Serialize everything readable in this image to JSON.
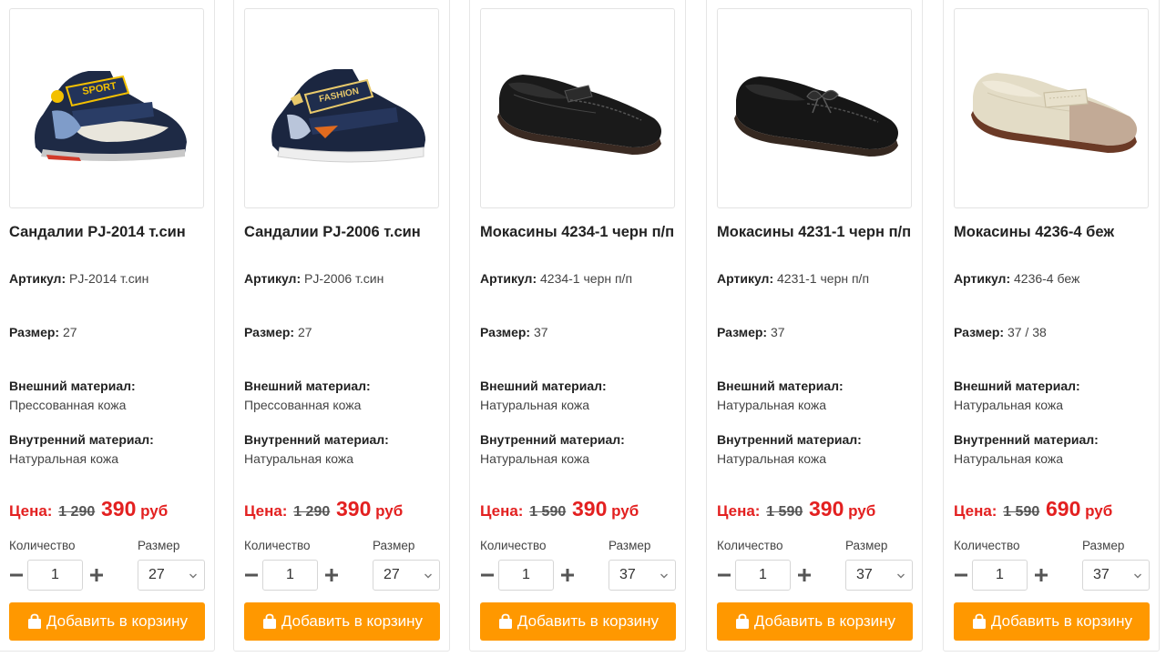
{
  "labels": {
    "article": "Артикул:",
    "size": "Размер:",
    "outer_material": "Внешний материал:",
    "inner_material": "Внутренний материал:",
    "price": "Цена:",
    "quantity": "Количество",
    "size_select": "Размер",
    "add_to_cart": "Добавить в корзину"
  },
  "colors": {
    "accent": "#ff9800",
    "price": "#e32020"
  },
  "products": [
    {
      "title": "Сандалии PJ-2014 т.син",
      "image": "navy-kids-sandal-sport",
      "article": "PJ-2014 т.син",
      "size": "27",
      "outer_material": "Прессованная кожа",
      "inner_material": "Натуральная кожа",
      "old_price": "1 290",
      "new_price": "390",
      "currency": "руб",
      "quantity": "1",
      "selected_size": "27"
    },
    {
      "title": "Сандалии PJ-2006 т.син",
      "image": "navy-kids-sandal-fashion",
      "article": "PJ-2006 т.син",
      "size": "27",
      "outer_material": "Прессованная кожа",
      "inner_material": "Натуральная кожа",
      "old_price": "1 290",
      "new_price": "390",
      "currency": "руб",
      "quantity": "1",
      "selected_size": "27"
    },
    {
      "title": "Мокасины 4234-1 черн п/п",
      "image": "black-loafer",
      "article": "4234-1 черн п/п",
      "size": "37",
      "outer_material": "Натуральная кожа",
      "inner_material": "Натуральная кожа",
      "old_price": "1 590",
      "new_price": "390",
      "currency": "руб",
      "quantity": "1",
      "selected_size": "37"
    },
    {
      "title": "Мокасины 4231-1 черн п/п",
      "image": "black-loafer-bow",
      "article": "4231-1 черн п/п",
      "size": "37",
      "outer_material": "Натуральная кожа",
      "inner_material": "Натуральная кожа",
      "old_price": "1 590",
      "new_price": "390",
      "currency": "руб",
      "quantity": "1",
      "selected_size": "37"
    },
    {
      "title": "Мокасины 4236-4 беж",
      "image": "beige-loafer",
      "article": "4236-4 беж",
      "size": "37 / 38",
      "outer_material": "Натуральная кожа",
      "inner_material": "Натуральная кожа",
      "old_price": "1 590",
      "new_price": "690",
      "currency": "руб",
      "quantity": "1",
      "selected_size": "37"
    }
  ]
}
